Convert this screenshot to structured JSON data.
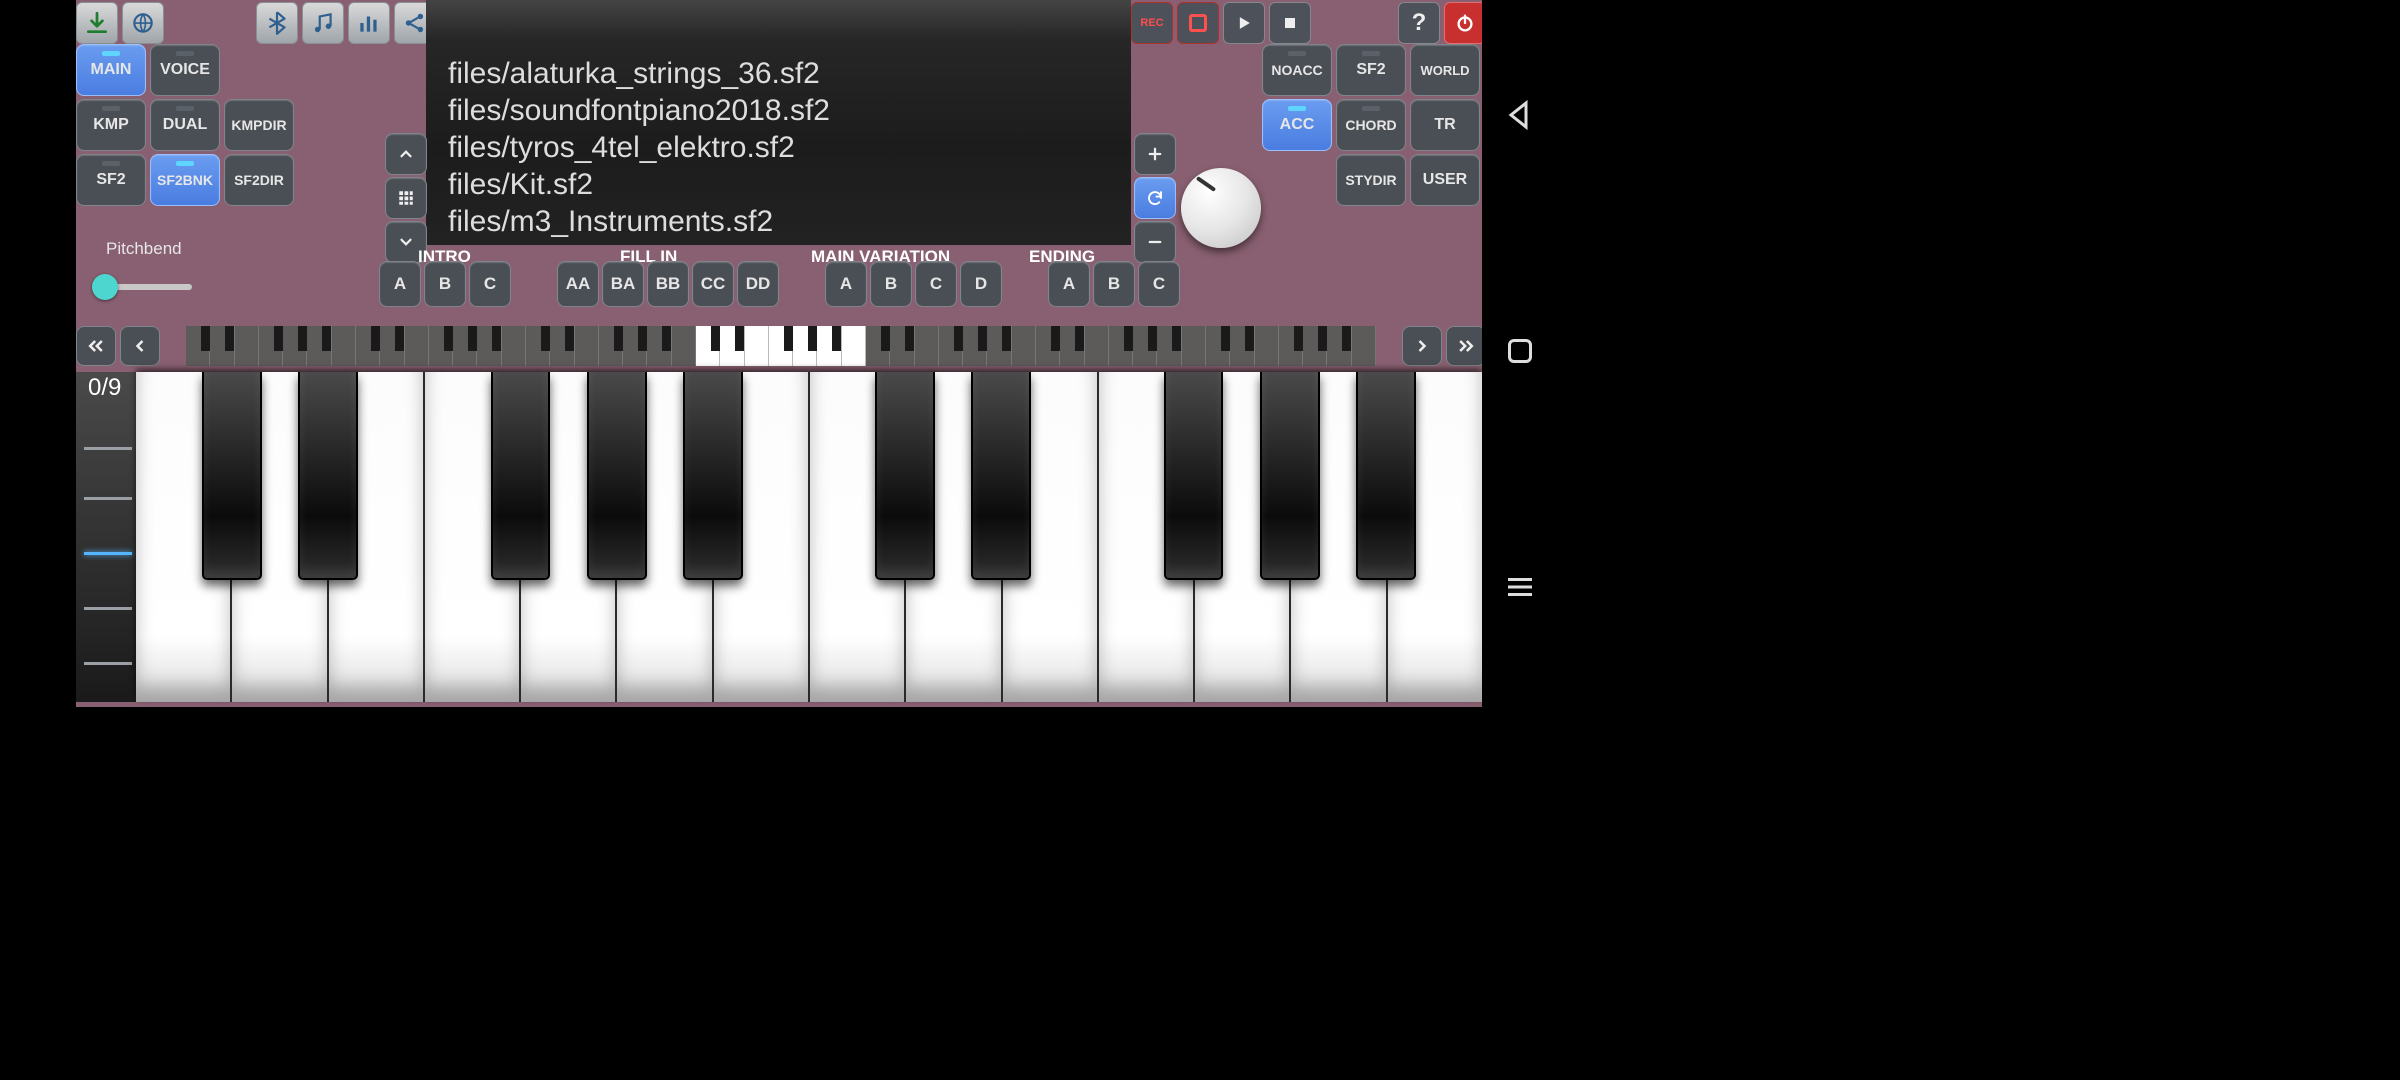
{
  "topIcons": {
    "download": "download-icon",
    "globe": "globe-icon",
    "bluetooth": "bluetooth-icon",
    "music": "music-icon",
    "equalizer": "equalizer-icon",
    "share": "share-icon"
  },
  "transport": {
    "rec": "REC"
  },
  "helpPower": {
    "help": "?",
    "power": "power-icon"
  },
  "leftModes": {
    "row1": [
      {
        "label": "MAIN",
        "active": true
      },
      {
        "label": "VOICE"
      }
    ],
    "row2": [
      {
        "label": "KMP"
      },
      {
        "label": "DUAL"
      },
      {
        "label": "KMPDIR"
      }
    ],
    "row3": [
      {
        "label": "SF2"
      },
      {
        "label": "SF2BNK",
        "active": true
      },
      {
        "label": "SF2DIR"
      }
    ]
  },
  "rightModes": {
    "row1": [
      {
        "label": "NOACC"
      },
      {
        "label": "SF2"
      },
      {
        "label": "WORLD"
      }
    ],
    "row2": [
      {
        "label": "ACC",
        "active": true
      },
      {
        "label": "CHORD"
      },
      {
        "label": "TR"
      }
    ],
    "row3": [
      {
        "label": ""
      },
      {
        "label": "STYDIR"
      },
      {
        "label": "USER"
      }
    ]
  },
  "fileList": [
    "files/alaturka_strings_36.sf2",
    "files/soundfontpiano2018.sf2",
    "files/tyros_4tel_elektro.sf2",
    "files/Kit.sf2",
    "files/m3_Instruments.sf2"
  ],
  "pitchbend": {
    "label": "Pitchbend"
  },
  "sections": {
    "intro": {
      "label": "INTRO",
      "buttons": [
        "A",
        "B",
        "C"
      ]
    },
    "fillin": {
      "label": "FILL IN",
      "buttons": [
        "AA",
        "BA",
        "BB",
        "CC",
        "DD"
      ]
    },
    "mainvar": {
      "label": "MAIN VARIATION",
      "buttons": [
        "A",
        "B",
        "C",
        "D"
      ]
    },
    "ending": {
      "label": "ENDING",
      "buttons": [
        "A",
        "B",
        "C"
      ]
    }
  },
  "octaveCounter": "0/9"
}
